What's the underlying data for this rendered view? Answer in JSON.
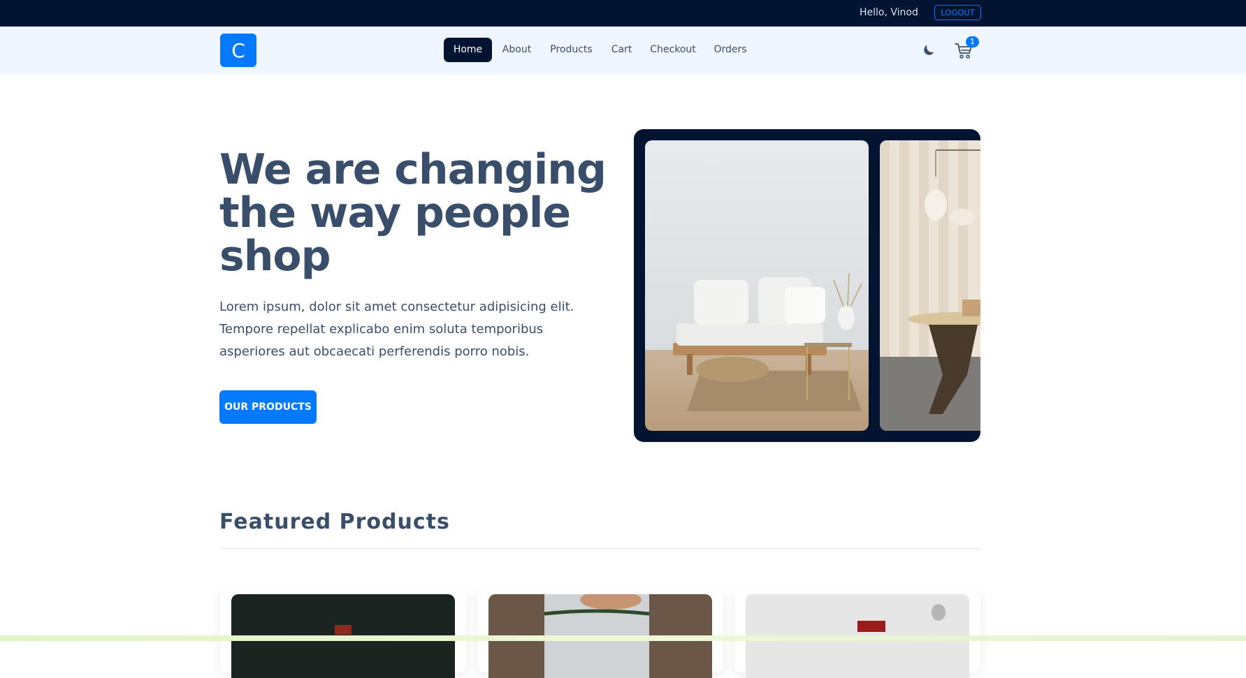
{
  "topbar": {
    "greeting": "Hello, Vinod",
    "logout_label": "LOGOUT"
  },
  "navbar": {
    "logo_letter": "C",
    "links": [
      {
        "label": "Home",
        "active": true
      },
      {
        "label": "About",
        "active": false
      },
      {
        "label": "Products",
        "active": false
      },
      {
        "label": "Cart",
        "active": false
      },
      {
        "label": "Checkout",
        "active": false
      },
      {
        "label": "Orders",
        "active": false
      }
    ],
    "theme_icon": "moon-icon",
    "cart_icon": "cart-icon",
    "cart_count": "1"
  },
  "hero": {
    "title": "We are changing the way people shop",
    "text": "Lorem ipsum, dolor sit amet consectetur adipisicing elit. Tempore repellat explicabo enim soluta temporibus asperiores aut obcaecati perferendis porro nobis.",
    "button_label": "OUR PRODUCTS"
  },
  "featured": {
    "title": "Featured Products"
  },
  "colors": {
    "topbar_bg": "#021431",
    "navbar_bg": "#f0f6ff",
    "primary": "#057aff",
    "text": "#394e6a"
  }
}
